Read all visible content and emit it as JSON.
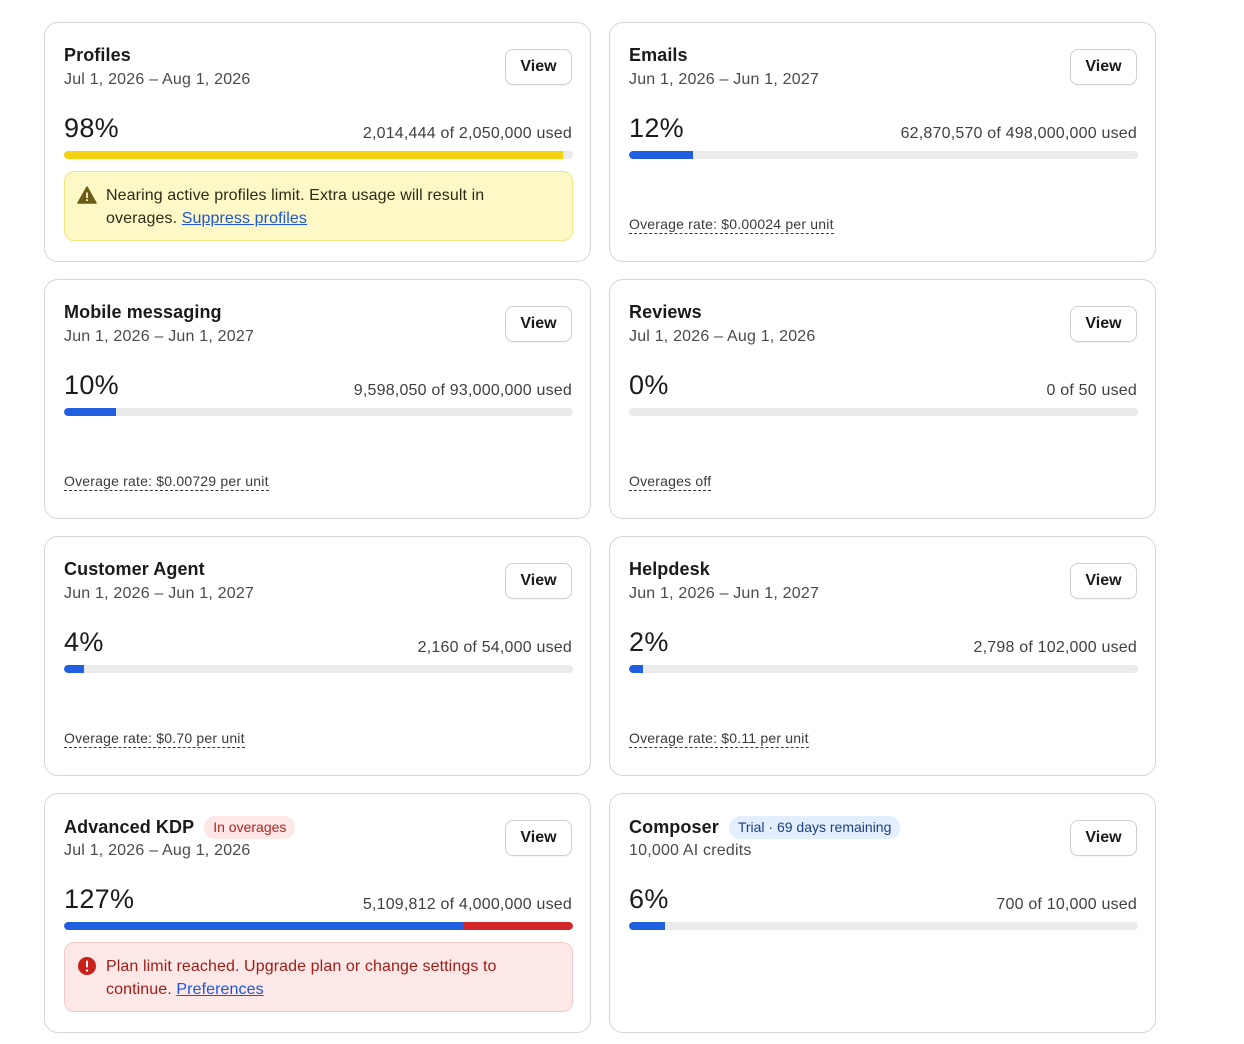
{
  "cards": [
    {
      "title": "Profiles",
      "date": "Jul 1, 2026 – Aug 1, 2026",
      "view_label": "View",
      "percent": "98%",
      "used": "2,014,444 of 2,050,000 used",
      "progress": 0.98,
      "bar_color": "#f5d20f",
      "alert": {
        "type": "warning",
        "icon": "warning-icon",
        "text": "Nearing active profiles limit. Extra usage will result in overages.",
        "link": "Suppress profiles"
      }
    },
    {
      "title": "Emails",
      "date": "Jun 1, 2026 – Jun 1, 2027",
      "view_label": "View",
      "percent": "12%",
      "used": "62,870,570 of 498,000,000 used",
      "progress": 0.126,
      "bar_color": "#1f5fe0",
      "overage": "Overage rate: $0.00024 per unit"
    },
    {
      "title": "Mobile messaging",
      "date": "Jun 1, 2026 – Jun 1, 2027",
      "view_label": "View",
      "percent": "10%",
      "used": "9,598,050 of 93,000,000 used",
      "progress": 0.103,
      "bar_color": "#1f5fe0",
      "overage": "Overage rate: $0.00729 per unit"
    },
    {
      "title": "Reviews",
      "date": "Jul 1, 2026 – Aug 1, 2026",
      "view_label": "View",
      "percent": "0%",
      "used": "0 of 50 used",
      "progress": 0,
      "bar_color": "#1f5fe0",
      "overage": "Overages off"
    },
    {
      "title": "Customer Agent",
      "date": "Jun 1, 2026 – Jun 1, 2027",
      "view_label": "View",
      "percent": "4%",
      "used": "2,160 of 54,000 used",
      "progress": 0.04,
      "bar_color": "#1f5fe0",
      "overage": "Overage rate: $0.70 per unit"
    },
    {
      "title": "Helpdesk",
      "date": "Jun 1, 2026 – Jun 1, 2027",
      "view_label": "View",
      "percent": "2%",
      "used": "2,798 of 102,000 used",
      "progress": 0.027,
      "bar_color": "#1f5fe0",
      "overage": "Overage rate: $0.11 per unit"
    },
    {
      "title": "Advanced KDP",
      "badge": "In overages",
      "badge_style": "red",
      "date": "Jul 1, 2026 – Aug 1, 2026",
      "view_label": "View",
      "percent": "127%",
      "used": "5,109,812 of 4,000,000 used",
      "progress": 1.0,
      "bar_color": "#1f5fe0",
      "over_fraction": 0.217,
      "over_color": "#d3262a",
      "alert": {
        "type": "error",
        "icon": "error-icon",
        "text": "Plan limit reached. Upgrade plan or change settings to continue.",
        "link": "Preferences"
      }
    },
    {
      "title": "Composer",
      "badge": "Trial · 69 days remaining",
      "badge_style": "blue",
      "date": "10,000 AI credits",
      "view_label": "View",
      "percent": "6%",
      "used": "700 of 10,000 used",
      "progress": 0.07,
      "bar_color": "#1f5fe0"
    }
  ]
}
